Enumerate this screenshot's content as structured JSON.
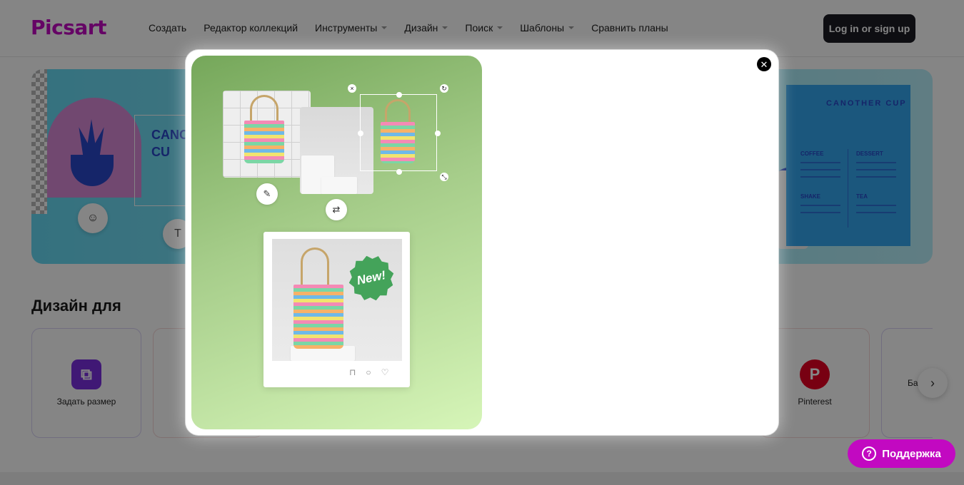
{
  "header": {
    "logo": "Picsart",
    "nav": [
      {
        "label": "Создать",
        "has_dropdown": false
      },
      {
        "label": "Редактор коллекций",
        "has_dropdown": false
      },
      {
        "label": "Инструменты",
        "has_dropdown": true
      },
      {
        "label": "Дизайн",
        "has_dropdown": true
      },
      {
        "label": "Поиск",
        "has_dropdown": true
      },
      {
        "label": "Шаблоны",
        "has_dropdown": true
      },
      {
        "label": "Сравнить планы",
        "has_dropdown": false
      }
    ],
    "login_label": "Log in or sign up"
  },
  "hero": {
    "left_vertical_text": "CANOT CU",
    "menu": {
      "title": "CANOTHER CUP",
      "col1_heading": "COFFEE",
      "col2_heading": "DESSERT",
      "col3_heading": "SHAKE",
      "col4_heading": "TEA"
    }
  },
  "section": {
    "title": "Дизайн для",
    "cards": [
      {
        "label": "Задать размер",
        "icon": "crop-icon",
        "color": "#7b2fe0"
      },
      {
        "label": "Pinterest",
        "icon": "pinterest-icon",
        "color": "#e60023"
      },
      {
        "label": "Банне",
        "icon": "banner-icon",
        "color": "#cccccc"
      }
    ]
  },
  "modal": {
    "close_icon": "close-icon",
    "post_badge": "New!"
  },
  "support": {
    "label": "Поддержка",
    "icon": "help-chat-icon"
  },
  "colors": {
    "brand": "#c209c1",
    "login_bg": "#1c1c24",
    "art_gradient_start": "#75a75a",
    "art_gradient_end": "#d6f5b8",
    "badge_green": "#44a35a"
  }
}
